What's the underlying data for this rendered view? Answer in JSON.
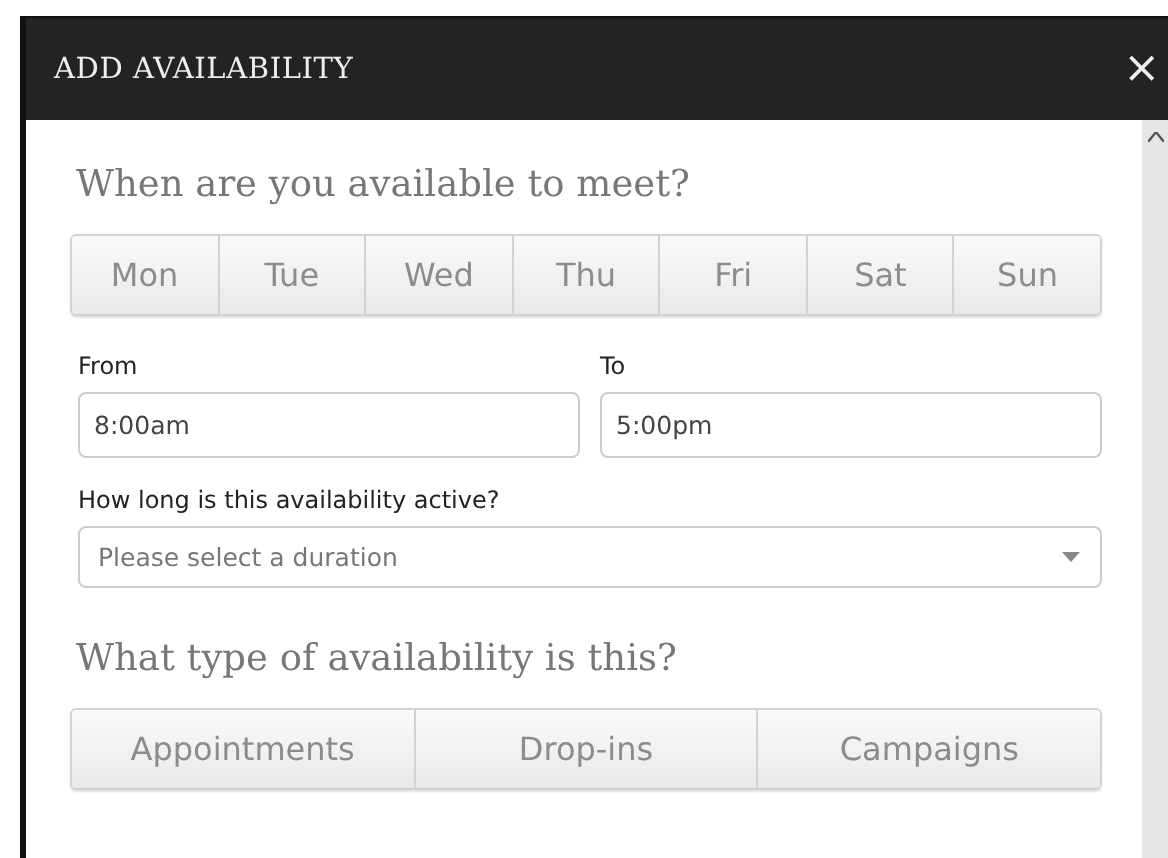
{
  "dialog": {
    "title": "ADD AVAILABILITY",
    "close": "×"
  },
  "days_heading": "When are you available to meet?",
  "days": [
    {
      "label": "Mon",
      "selected": false
    },
    {
      "label": "Tue",
      "selected": false
    },
    {
      "label": "Wed",
      "selected": false
    },
    {
      "label": "Thu",
      "selected": false
    },
    {
      "label": "Fri",
      "selected": false
    },
    {
      "label": "Sat",
      "selected": false
    },
    {
      "label": "Sun",
      "selected": false
    }
  ],
  "from": {
    "label": "From",
    "value": "8:00am"
  },
  "to": {
    "label": "To",
    "value": "5:00pm"
  },
  "duration": {
    "label": "How long is this availability active?",
    "placeholder": "Please select a duration"
  },
  "type_heading": "What type of availability is this?",
  "types": [
    {
      "label": "Appointments",
      "selected": false
    },
    {
      "label": "Drop-ins",
      "selected": false
    },
    {
      "label": "Campaigns",
      "selected": false
    }
  ]
}
